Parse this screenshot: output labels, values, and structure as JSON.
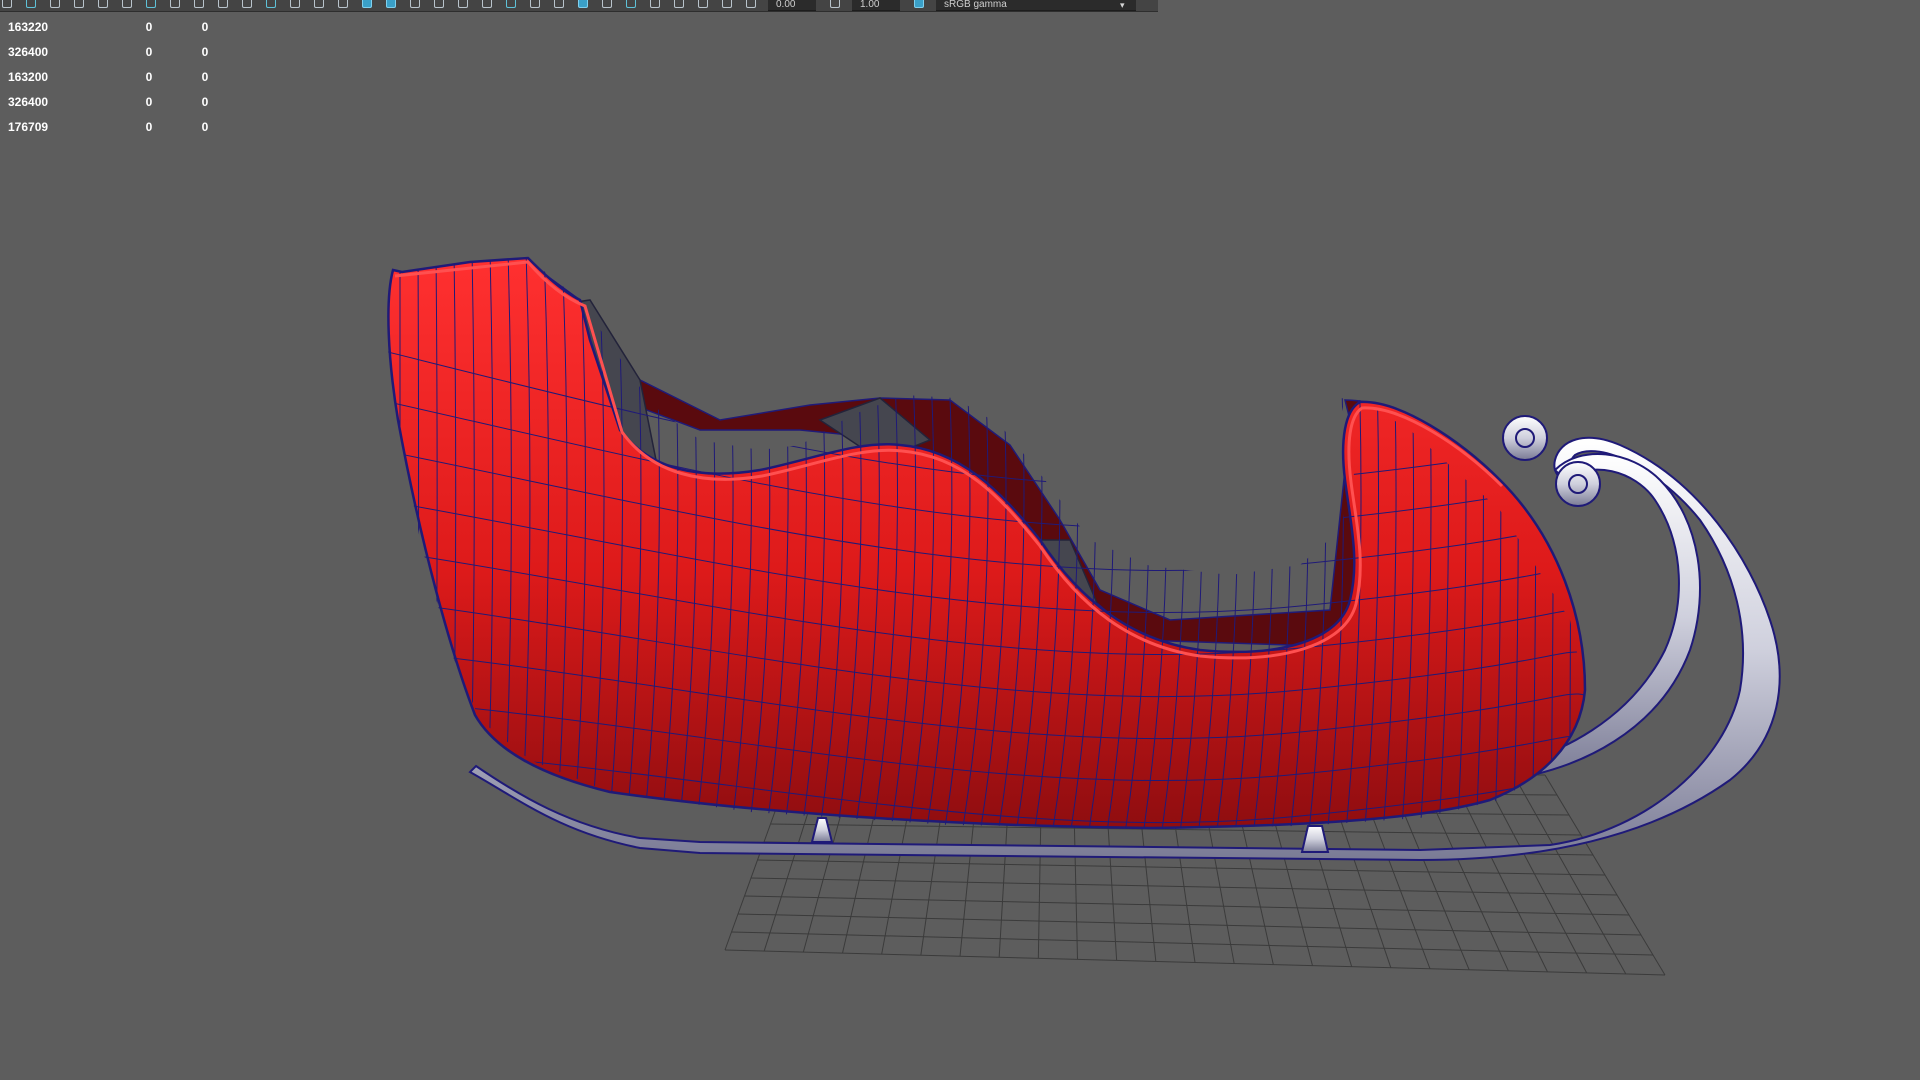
{
  "toolbar": {
    "exposure_value": "0.00",
    "gamma_value": "1.00",
    "color_space": "sRGB gamma",
    "dropdown_glyph": "▾",
    "icons": [
      "select-icon",
      "lasso-icon",
      "paint-icon",
      "move-icon",
      "rotate-icon",
      "scale-icon",
      "grid-icon",
      "film-gate-icon",
      "resolution-gate-icon",
      "gate-mask-icon",
      "field-chart-icon",
      "safe-action-icon",
      "safe-title-icon",
      "wireframe-icon",
      "smooth-shade-icon",
      "default-material-icon",
      "textured-icon",
      "use-lights-icon",
      "shadows-icon",
      "ssao-icon",
      "motion-blur-icon",
      "anti-alias-icon",
      "depth-of-field-icon",
      "isolate-select-icon",
      "xray-icon",
      "xray-joints-icon",
      "backface-icon",
      "camera-attributes-icon",
      "bookmark-icon",
      "image-plane-icon",
      "two-d-pan-icon",
      "exposure-icon",
      "gamma-icon",
      "color-management-icon"
    ]
  },
  "hud": {
    "rows": [
      {
        "label": "163220",
        "c1": "0",
        "c2": "0"
      },
      {
        "label": "326400",
        "c1": "0",
        "c2": "0"
      },
      {
        "label": "163200",
        "c1": "0",
        "c2": "0"
      },
      {
        "label": "326400",
        "c1": "0",
        "c2": "0"
      },
      {
        "label": "176709",
        "c1": "0",
        "c2": "0"
      }
    ]
  },
  "scene": {
    "colors": {
      "background": "#5d5d5d",
      "body": "#e01c1c",
      "body_dark": "#8a0f12",
      "interior": "#5a0a0e",
      "wire": "#1f1a78",
      "runner": "#d9d9e6",
      "ground_grid": "#3c3c3c",
      "seat": "#45464f"
    }
  }
}
